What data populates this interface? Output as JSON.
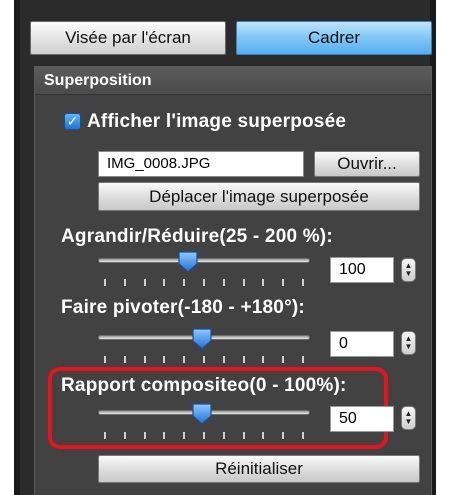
{
  "mode_buttons": {
    "live_view": "Visée par l'écran",
    "frame": "Cadrer"
  },
  "panel": {
    "title": "Superposition"
  },
  "overlay": {
    "show_checkbox_label": "Afficher l'image superposée",
    "show_checked": true,
    "file_name": "IMG_0008.JPG",
    "open_button": "Ouvrir...",
    "move_button": "Déplacer l'image superposée"
  },
  "scale": {
    "label": "Agrandir/Réduire(25 - 200 %):",
    "value": "100",
    "min": 25,
    "max": 200,
    "current": 100
  },
  "rotate": {
    "label": "Faire pivoter(-180 - +180°):",
    "value": "0",
    "min": -180,
    "max": 180,
    "current": 0
  },
  "composite": {
    "label": "Rapport compositeo(0 - 100%):",
    "value": "50",
    "min": 0,
    "max": 100,
    "current": 50
  },
  "reset_button": "Réinitialiser",
  "colors": {
    "accent": "#54aef0",
    "highlight": "#e8141b",
    "panel": "#424242"
  }
}
